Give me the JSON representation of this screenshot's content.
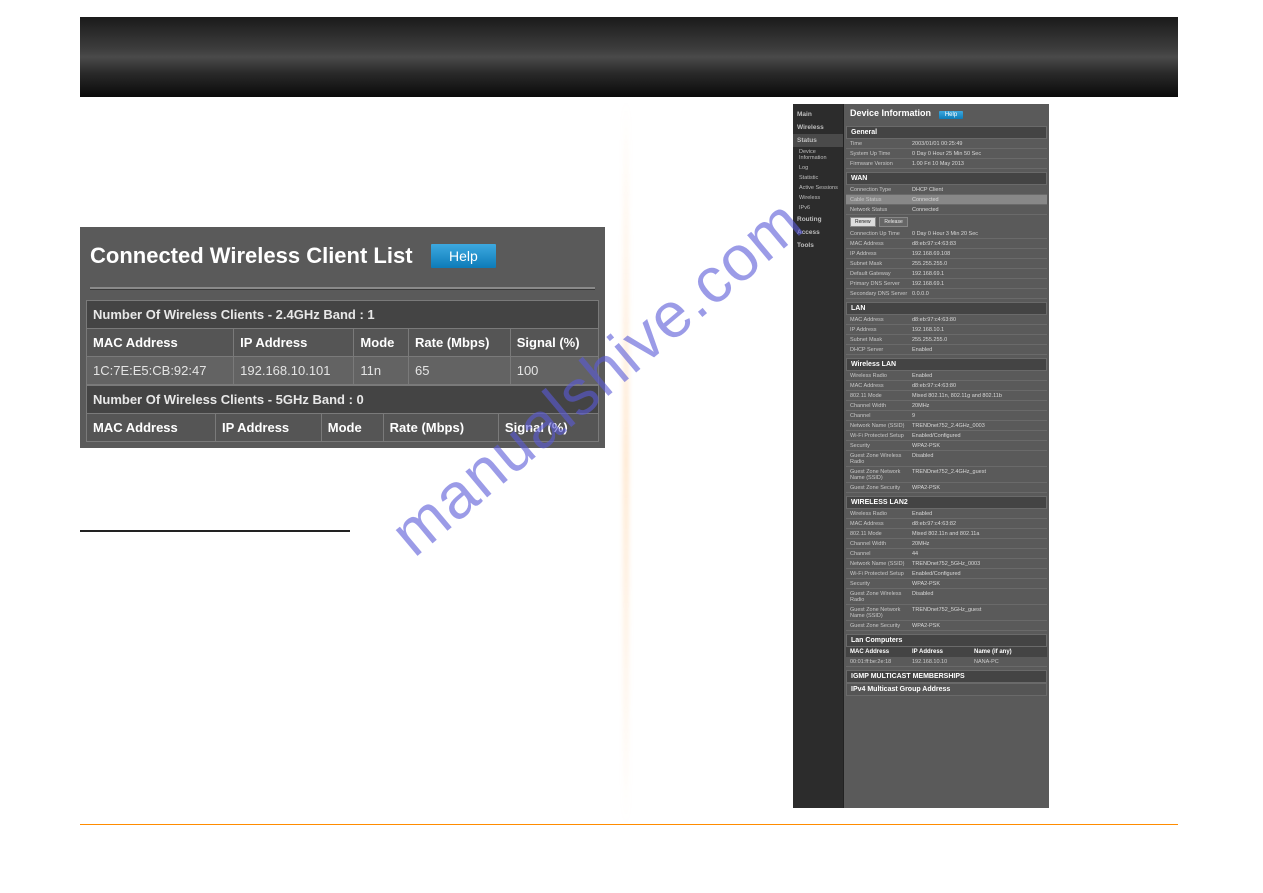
{
  "watermark": "manualshive.com",
  "left_panel": {
    "title": "Connected Wireless Client List",
    "help_label": "Help",
    "band24_header": "Number Of Wireless Clients - 2.4GHz Band : 1",
    "band5_header": "Number Of Wireless Clients - 5GHz Band : 0",
    "cols": {
      "mac": "MAC Address",
      "ip": "IP Address",
      "mode": "Mode",
      "rate": "Rate (Mbps)",
      "signal": "Signal (%)"
    },
    "rows24": [
      {
        "mac": "1C:7E:E5:CB:92:47",
        "ip": "192.168.10.101",
        "mode": "11n",
        "rate": "65",
        "signal": "100"
      }
    ]
  },
  "right_panel": {
    "title": "Device Information",
    "help_label": "Help",
    "sidebar": {
      "main": "Main",
      "wireless": "Wireless",
      "status": "Status",
      "status_items": {
        "device_info": "Device Information",
        "log": "Log",
        "statistic": "Statistic",
        "active_sessions": "Active Sessions",
        "wireless_sub": "Wireless",
        "ipv6": "IPv6"
      },
      "routing": "Routing",
      "access": "Access",
      "tools": "Tools"
    },
    "general": {
      "title": "General",
      "time_l": "Time",
      "time_v": "2003/01/01 00:25:49",
      "uptime_l": "System Up Time",
      "uptime_v": "0 Day 0 Hour 25 Min 50 Sec",
      "fw_l": "Firmware Version",
      "fw_v": "1.00 Fri 10 May 2013"
    },
    "wan": {
      "title": "WAN",
      "conntype_l": "Connection Type",
      "conntype_v": "DHCP Client",
      "cable_l": "Cable Status",
      "cable_v": "Connected",
      "net_l": "Network Status",
      "net_v": "Connected",
      "renew_btn": "Renew",
      "release_btn": "Release",
      "cuptime_l": "Connection Up Time",
      "cuptime_v": "0 Day 0 Hour 3 Min 20 Sec",
      "mac_l": "MAC Address",
      "mac_v": "d8:eb:97:c4:63:83",
      "ip_l": "IP Address",
      "ip_v": "192.168.69.108",
      "mask_l": "Subnet Mask",
      "mask_v": "255.255.255.0",
      "gw_l": "Default Gateway",
      "gw_v": "192.168.69.1",
      "dns1_l": "Primary DNS Server",
      "dns1_v": "192.168.69.1",
      "dns2_l": "Secondary DNS Server",
      "dns2_v": "0.0.0.0"
    },
    "lan": {
      "title": "LAN",
      "mac_l": "MAC Address",
      "mac_v": "d8:eb:97:c4:63:80",
      "ip_l": "IP Address",
      "ip_v": "192.168.10.1",
      "mask_l": "Subnet Mask",
      "mask_v": "255.255.255.0",
      "dhcp_l": "DHCP Server",
      "dhcp_v": "Enabled"
    },
    "wlan": {
      "title": "Wireless LAN",
      "radio_l": "Wireless Radio",
      "radio_v": "Enabled",
      "mac_l": "MAC Address",
      "mac_v": "d8:eb:97:c4:63:80",
      "mode_l": "802.11 Mode",
      "mode_v": "Mixed 802.11n, 802.11g and 802.11b",
      "chwidth_l": "Channel Width",
      "chwidth_v": "20MHz",
      "ch_l": "Channel",
      "ch_v": "9",
      "ssid_l": "Network Name (SSID)",
      "ssid_v": "TRENDnet752_2.4GHz_0003",
      "wps_l": "Wi-Fi Protected Setup",
      "wps_v": "Enabled/Configured",
      "sec_l": "Security",
      "sec_v": "WPA2-PSK",
      "gradio_l": "Guest Zone Wireless Radio",
      "gradio_v": "Disabled",
      "gssid_l": "Guest Zone Network Name (SSID)",
      "gssid_v": "TRENDnet752_2.4GHz_guest",
      "gsec_l": "Guest Zone Security",
      "gsec_v": "WPA2-PSK"
    },
    "wlan2": {
      "title": "WIRELESS LAN2",
      "radio_l": "Wireless Radio",
      "radio_v": "Enabled",
      "mac_l": "MAC Address",
      "mac_v": "d8:eb:97:c4:63:82",
      "mode_l": "802.11 Mode",
      "mode_v": "Mixed 802.11n and 802.11a",
      "chwidth_l": "Channel Width",
      "chwidth_v": "20MHz",
      "ch_l": "Channel",
      "ch_v": "44",
      "ssid_l": "Network Name (SSID)",
      "ssid_v": "TRENDnet752_5GHz_0003",
      "wps_l": "Wi-Fi Protected Setup",
      "wps_v": "Enabled/Configured",
      "sec_l": "Security",
      "sec_v": "WPA2-PSK",
      "gradio_l": "Guest Zone Wireless Radio",
      "gradio_v": "Disabled",
      "gssid_l": "Guest Zone Network Name (SSID)",
      "gssid_v": "TRENDnet752_5GHz_guest",
      "gsec_l": "Guest Zone Security",
      "gsec_v": "WPA2-PSK"
    },
    "lan_computers": {
      "title": "Lan Computers",
      "col_mac": "MAC Address",
      "col_ip": "IP Address",
      "col_name": "Name (if any)",
      "row": {
        "mac": "00:01:ff:be:2e:18",
        "ip": "192.168.10.10",
        "name": "NANA-PC"
      }
    },
    "igmp": {
      "title": "IGMP MULTICAST MEMBERSHIPS",
      "sub": "IPv4 Multicast Group Address"
    }
  }
}
